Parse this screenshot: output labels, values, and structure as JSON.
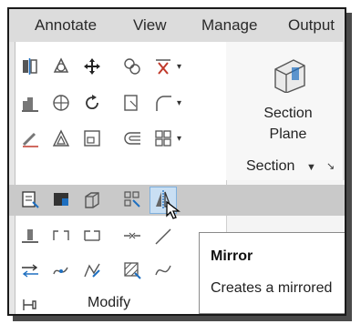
{
  "menu": {
    "annotate": "Annotate",
    "view": "View",
    "manage": "Manage",
    "output": "Output"
  },
  "section_panel": {
    "button_line1": "Section",
    "button_line2": "Plane",
    "panel_title": "Section",
    "dropdown_arrow": "▼",
    "launcher": "↘"
  },
  "modify_panel": {
    "title": "Modify"
  },
  "tooltip": {
    "title": "Mirror",
    "description": "Creates a mirrored"
  },
  "colors": {
    "accent_blue": "#1e6fc0",
    "hover_highlight": "#c9dff3"
  }
}
